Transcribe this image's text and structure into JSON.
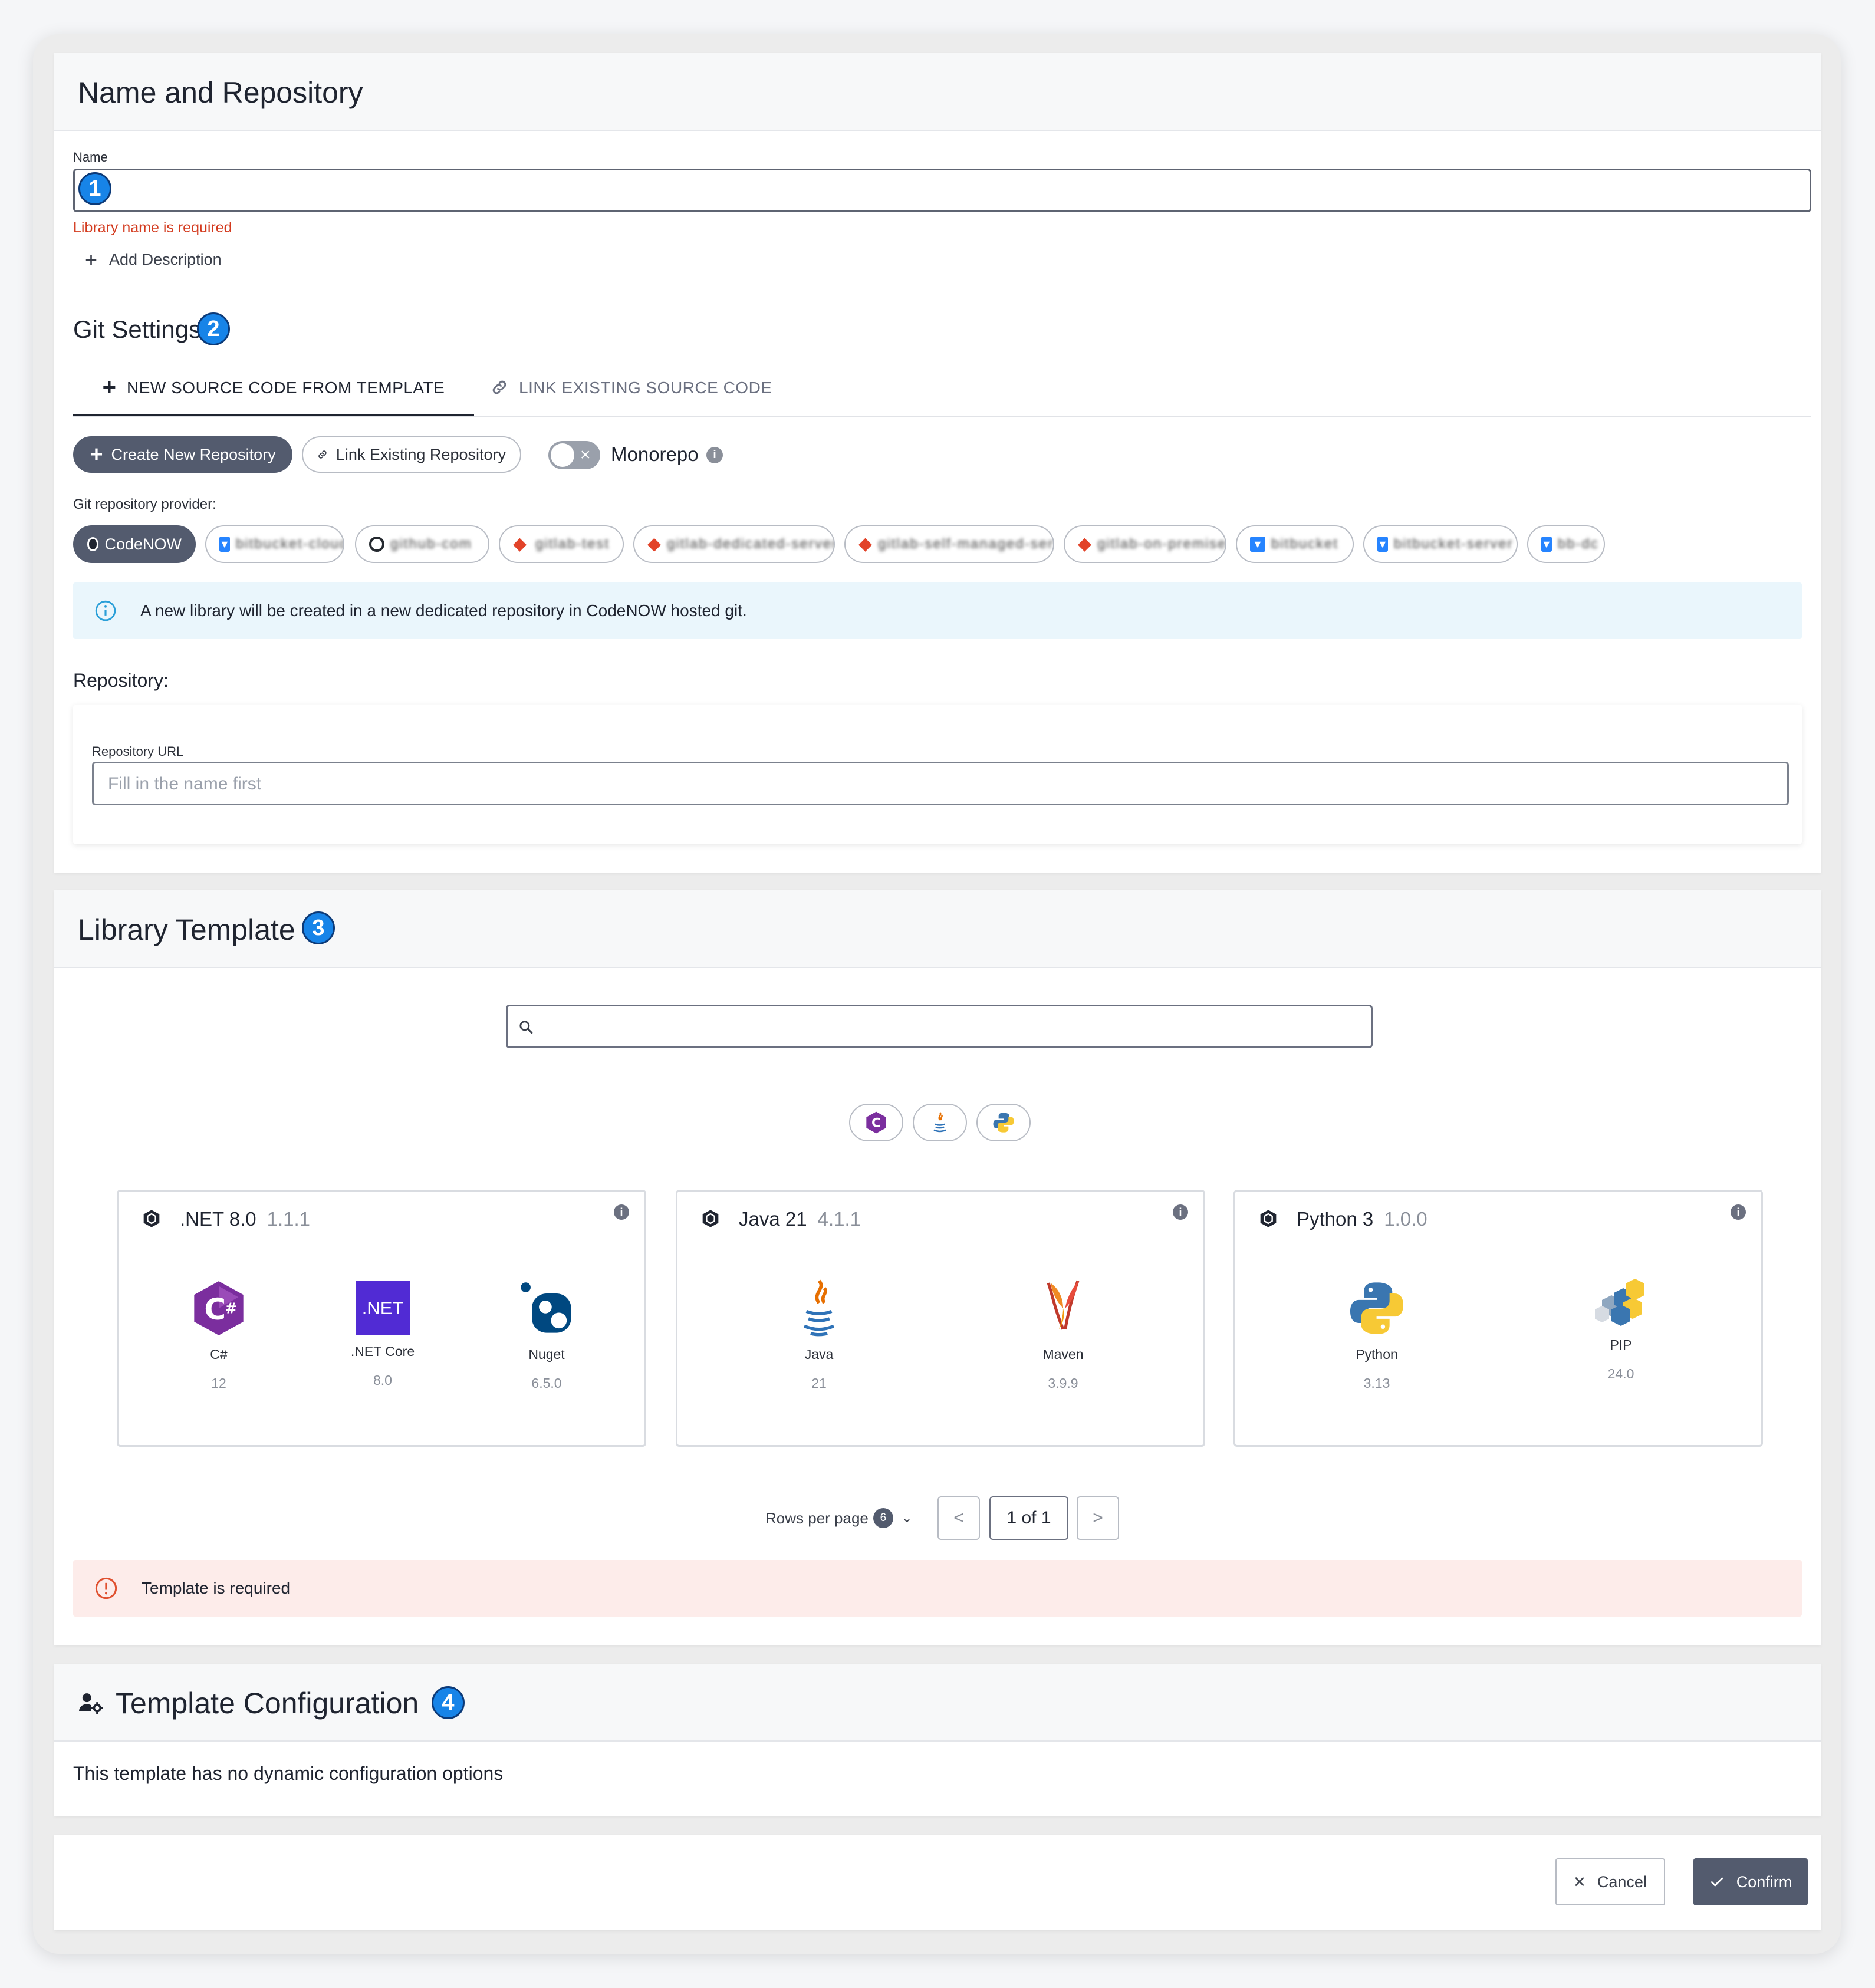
{
  "name_repo": {
    "title": "Name and Repository",
    "badge": "1",
    "name_label": "Name",
    "name_value": "",
    "name_error": "Library name is required",
    "add_description": "Add Description"
  },
  "git": {
    "title": "Git Settings",
    "badge": "2",
    "tabs": [
      {
        "label": "NEW SOURCE CODE FROM TEMPLATE",
        "active": true
      },
      {
        "label": "LINK EXISTING SOURCE CODE",
        "active": false
      }
    ],
    "create_repo": "Create New Repository",
    "link_repo": "Link Existing Repository",
    "monorepo": "Monorepo",
    "provider_label": "Git repository provider:",
    "providers": [
      {
        "label": "CodeNOW",
        "icon": "codenow-icon",
        "selected": true
      },
      {
        "label": "bitbucket-cloud",
        "icon": "bitbucket-icon"
      },
      {
        "label": "github-com",
        "icon": "github-icon"
      },
      {
        "label": "gitlab-test",
        "icon": "gitlab-icon"
      },
      {
        "label": "gitlab-dedicated-server",
        "icon": "gitlab-icon"
      },
      {
        "label": "gitlab-self-managed-server",
        "icon": "gitlab-icon"
      },
      {
        "label": "gitlab-on-premise",
        "icon": "gitlab-icon"
      },
      {
        "label": "bitbucket",
        "icon": "bitbucket-icon"
      },
      {
        "label": "bitbucket-server",
        "icon": "bitbucket-icon"
      },
      {
        "label": "bb-dc",
        "icon": "bitbucket-icon"
      }
    ],
    "info": "A new library will be created in a new dedicated repository in CodeNOW hosted git.",
    "repository_label": "Repository:",
    "repo_url_label": "Repository URL",
    "repo_url_placeholder": "Fill in the name first"
  },
  "template": {
    "title": "Library Template",
    "badge": "3",
    "search_placeholder": "",
    "filters": [
      "csharp-icon",
      "java-icon",
      "python-icon"
    ],
    "cards": [
      {
        "title": ".NET 8.0",
        "version": "1.1.1",
        "techs": [
          {
            "name": "C#",
            "version": "12"
          },
          {
            "name": ".NET Core",
            "version": "8.0",
            "logo_text": ".NET"
          },
          {
            "name": "Nuget",
            "version": "6.5.0"
          }
        ]
      },
      {
        "title": "Java 21",
        "version": "4.1.1",
        "techs": [
          {
            "name": "Java",
            "version": "21"
          },
          {
            "name": "Maven",
            "version": "3.9.9"
          }
        ]
      },
      {
        "title": "Python 3",
        "version": "1.0.0",
        "techs": [
          {
            "name": "Python",
            "version": "3.13"
          },
          {
            "name": "PIP",
            "version": "24.0"
          }
        ]
      }
    ],
    "rows_per_page_label": "Rows per page",
    "rows_per_page_value": "6",
    "page_prev": "<",
    "page_indicator": "1 of 1",
    "page_next": ">",
    "error": "Template is required"
  },
  "config": {
    "title": "Template Configuration",
    "badge": "4",
    "text": "This template has no dynamic configuration options"
  },
  "actions": {
    "cancel": "Cancel",
    "confirm": "Confirm"
  },
  "colors": {
    "accent": "#1784e8",
    "dark_button": "#535b6e",
    "error": "#d33a1e",
    "info_bg": "#eaf6fc",
    "error_bg": "#fdecea"
  }
}
